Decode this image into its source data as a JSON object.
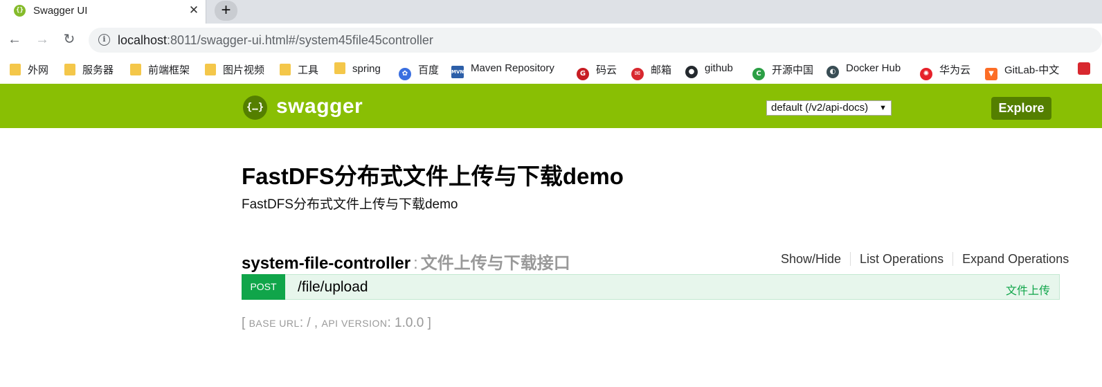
{
  "browser": {
    "tab_title": "Swagger UI",
    "tab_close": "✕",
    "new_tab": "+",
    "url_host": "localhost",
    "url_rest": ":8011/swagger-ui.html#/system45file45controller"
  },
  "bookmarks": [
    {
      "label": "外网",
      "icon": "folder-icon"
    },
    {
      "label": "服务器",
      "icon": "folder-icon"
    },
    {
      "label": "前端框架",
      "icon": "folder-icon"
    },
    {
      "label": "图片视频",
      "icon": "folder-icon"
    },
    {
      "label": "工具",
      "icon": "folder-icon"
    },
    {
      "label": "spring",
      "icon": "folder-icon"
    },
    {
      "label": "百度",
      "icon": "baidu-icon"
    },
    {
      "label": "Maven Repository",
      "icon": "maven-icon"
    },
    {
      "label": "码云",
      "icon": "gitee-icon"
    },
    {
      "label": "邮箱",
      "icon": "mail-icon"
    },
    {
      "label": "github",
      "icon": "github-icon"
    },
    {
      "label": "开源中国",
      "icon": "oschina-icon"
    },
    {
      "label": "Docker Hub",
      "icon": "docker-icon"
    },
    {
      "label": "华为云",
      "icon": "huawei-icon"
    },
    {
      "label": "GitLab-中文",
      "icon": "gitlab-icon"
    }
  ],
  "swagger": {
    "brand": "swagger",
    "logo_glyph": "{…}",
    "spec_select": "default (/v2/api-docs)",
    "explore_label": "Explore",
    "header_color": "#89bf04"
  },
  "api": {
    "title": "FastDFS分布式文件上传与下载demo",
    "description": "FastDFS分布式文件上传与下载demo"
  },
  "resource": {
    "name": "system-file-controller",
    "separator": ":",
    "description": "文件上传与下载接口",
    "ops": [
      "Show/Hide",
      "List Operations",
      "Expand Operations"
    ]
  },
  "operation": {
    "method": "POST",
    "path": "/file/upload",
    "summary": "文件上传",
    "method_color": "#10a54a"
  },
  "footer": {
    "open": "[",
    "base_url_label": "BASE URL",
    "base_url_value": ": / ,",
    "api_version_label": "API VERSION",
    "api_version_value": ": 1.0.0",
    "close": "]"
  }
}
